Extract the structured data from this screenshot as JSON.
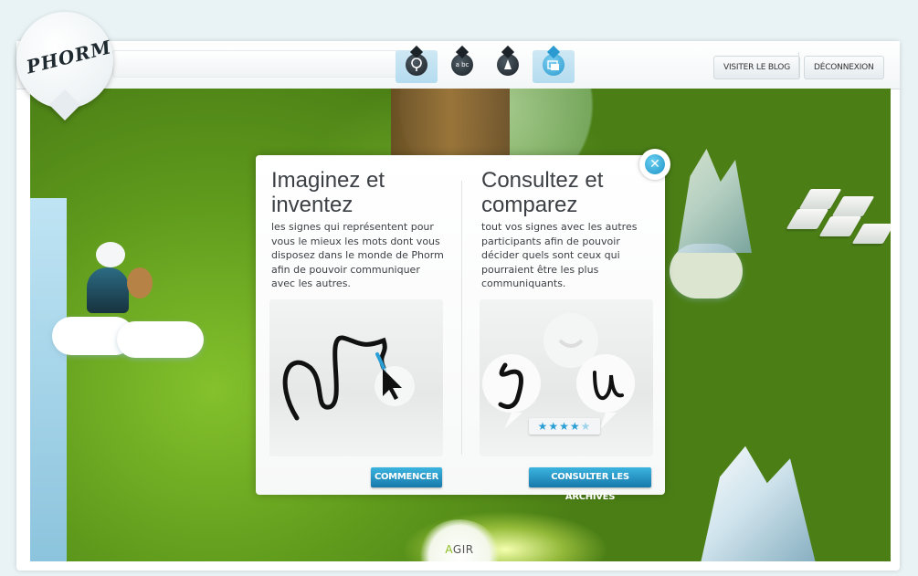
{
  "logo": {
    "text": "PHORM"
  },
  "toolbar": {
    "tools": [
      {
        "icon": "tree-drop-icon",
        "active": true
      },
      {
        "icon": "abc-drop-icon",
        "glyph": "a bc",
        "active": false
      },
      {
        "icon": "pen-drop-icon",
        "active": false
      },
      {
        "icon": "gallery-drop-icon",
        "active": true
      }
    ],
    "visit_blog_label": "VISITER LE BLOG",
    "logout_label": "DÉCONNEXION"
  },
  "modal": {
    "create": {
      "title": "Imaginez et inventez",
      "description": "les signes qui représentent pour vous le mieux les mots dont vous disposez dans le monde de Phorm afin de pouvoir communiquer avec les autres.",
      "button_label": "COMMENCER"
    },
    "compare": {
      "title": "Consultez et comparez",
      "description": "tout vos signes avec les autres participants afin de pouvoir décider quels sont ceux qui pourraient être les plus communiquants.",
      "button_label": "CONSULTER LES ARCHIVES",
      "rating": {
        "value": 4,
        "max": 5,
        "stars": "★★★★★"
      }
    },
    "close_icon": "close-icon"
  },
  "agir": {
    "prefix": "A",
    "rest": "GIR"
  },
  "colors": {
    "accent": "#2a9fd6",
    "grass": "#6faa22",
    "highlight": "#8bbe1d"
  }
}
